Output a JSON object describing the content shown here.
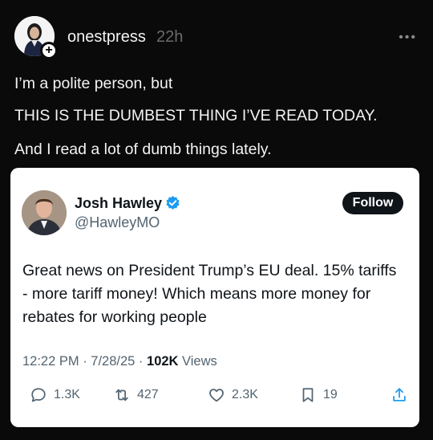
{
  "post": {
    "username": "onestpress",
    "time": "22h",
    "lines": [
      "I’m a polite person, but",
      "THIS IS THE DUMBEST THING I’VE READ TODAY.",
      "And I read a lot of dumb things lately."
    ]
  },
  "quote": {
    "name": "Josh Hawley",
    "handle": "@HawleyMO",
    "follow_label": "Follow",
    "text": "Great news on President Trump’s EU deal. 15% tariffs - more tariff money! Which means more money for rebates for working people",
    "time": "12:22 PM · 7/28/25 · ",
    "views_count": "102K",
    "views_label": " Views",
    "stats": {
      "replies": "1.3K",
      "reposts": "427",
      "likes": "2.3K",
      "bookmarks": "19"
    }
  },
  "icons": [
    "avatar-plus-icon",
    "more-icon",
    "verified-icon",
    "reply-icon",
    "retweet-icon",
    "like-icon",
    "bookmark-icon",
    "share-icon"
  ]
}
